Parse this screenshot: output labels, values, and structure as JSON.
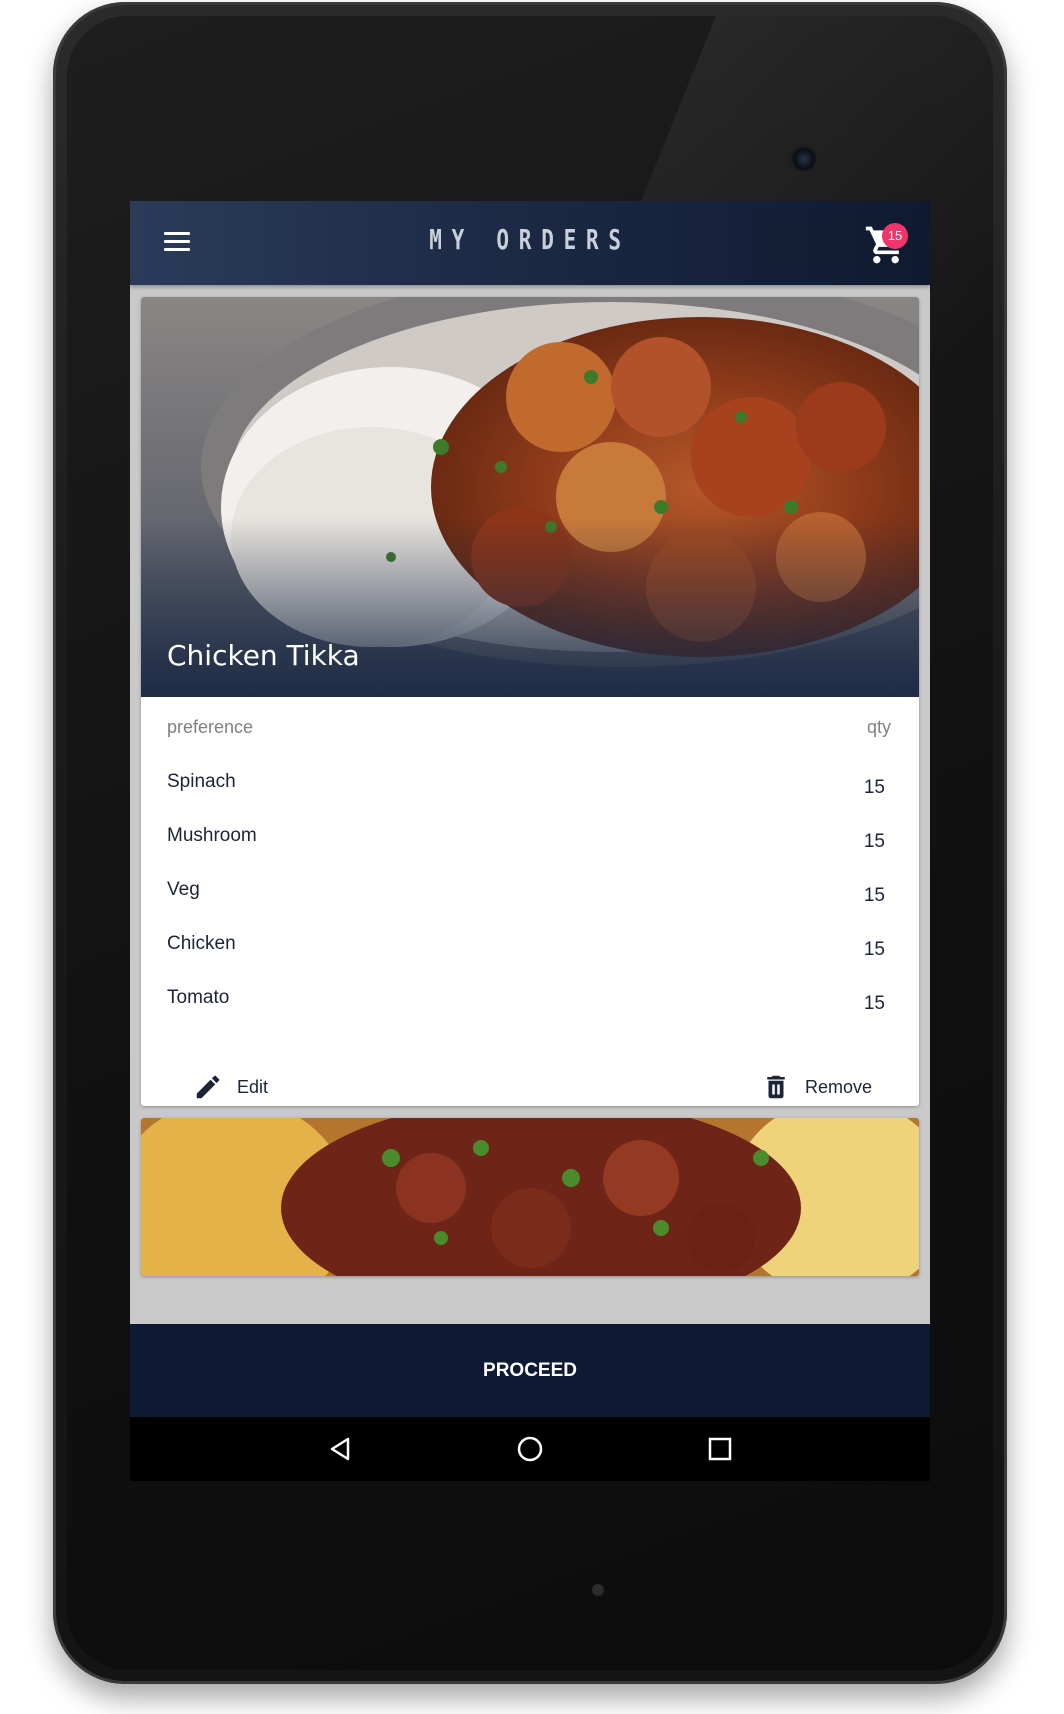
{
  "appbar": {
    "title": "MY ORDERS",
    "cart_count": "15"
  },
  "order": {
    "dish_name": "Chicken Tikka",
    "preference_header": "preference",
    "qty_header": "qty",
    "items": [
      {
        "name": "Spinach",
        "qty": "15"
      },
      {
        "name": "Mushroom",
        "qty": "15"
      },
      {
        "name": "Veg",
        "qty": "15"
      },
      {
        "name": "Chicken",
        "qty": "15"
      },
      {
        "name": "Tomato",
        "qty": "15"
      }
    ],
    "edit_label": "Edit",
    "remove_label": "Remove"
  },
  "footer": {
    "proceed_label": "PROCEED"
  },
  "colors": {
    "appbar": "#1c2a45",
    "badge": "#f0356a",
    "proceed_bg": "#0e1a33"
  },
  "icons": [
    "menu-icon",
    "cart-icon",
    "edit-icon",
    "trash-icon",
    "back-icon",
    "home-icon",
    "recents-icon"
  ]
}
